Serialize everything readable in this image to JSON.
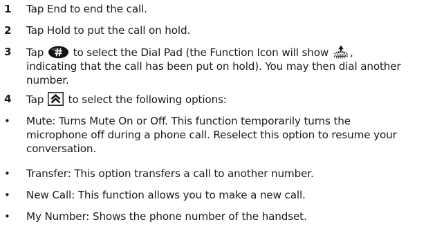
{
  "steps": [
    {
      "num": "1",
      "text": "Tap End to end the call."
    },
    {
      "num": "2",
      "text": "Tap Hold to put the call on hold."
    },
    {
      "num": "3",
      "before_icon": "Tap",
      "icon": "dial-pad-hash-icon",
      "after_icon": "to select the Dial Pad (the Function Icon will show",
      "icon2": "call-on-hold-icon",
      "line2": "indicating that the call has been put on hold). You may then dial another",
      "line3": "number."
    },
    {
      "num": "4",
      "before_icon": "Tap",
      "icon": "double-chevron-up-icon",
      "after_icon": "to select the following options:"
    }
  ],
  "bullets": [
    {
      "line1": "Mute: Turns Mute On or Off. This function temporarily turns the",
      "line2": "microphone off during a phone call. Reselect this option to resume your",
      "line3": "conversation."
    },
    {
      "line1": "Transfer: This option transfers a call to another number."
    },
    {
      "line1": "New Call: This function allows you to make a new call."
    },
    {
      "line1": "My Number: Shows the phone number of the handset."
    }
  ],
  "bullet_glyph": "•"
}
